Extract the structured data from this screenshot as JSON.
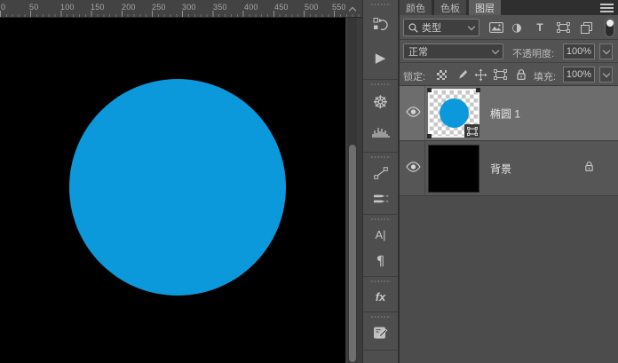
{
  "colors": {
    "shape_blue": "#0b99db",
    "canvas_black": "#000000",
    "panel_bg": "#535353",
    "selected_row": "#6d6d6d"
  },
  "ruler": {
    "labels": [
      "0",
      "50",
      "100",
      "150",
      "200",
      "250",
      "300",
      "350",
      "400",
      "450",
      "500",
      "550"
    ]
  },
  "dock": {
    "icons": [
      {
        "name": "history-panel-icon"
      },
      {
        "name": "actions-panel-icon",
        "glyph": "▶"
      },
      {
        "name": "navigator-panel-icon",
        "glyph": "☸"
      },
      {
        "name": "histogram-panel-icon"
      },
      {
        "name": "info-panel-icon"
      },
      {
        "name": "brush-panel-icon"
      },
      {
        "name": "character-panel-icon",
        "glyph": "A|"
      },
      {
        "name": "paragraph-panel-icon",
        "glyph": "¶"
      },
      {
        "name": "styles-panel-icon",
        "glyph": "fx"
      },
      {
        "name": "clone-source-panel-icon"
      }
    ]
  },
  "panel": {
    "tabs": [
      {
        "label": "颜色",
        "active": false
      },
      {
        "label": "色板",
        "active": false
      },
      {
        "label": "图层",
        "active": true
      }
    ],
    "filter": {
      "search_label": "类型",
      "adjustment_glyph": "◑",
      "type_glyph": "T"
    },
    "blend_mode": "正常",
    "opacity_label": "不透明度:",
    "opacity_value": "100%",
    "lock_label": "锁定:",
    "fill_label": "填充:",
    "fill_value": "100%",
    "layers": [
      {
        "name": "椭圆 1",
        "visible": true,
        "selected": true,
        "kind": "shape"
      },
      {
        "name": "背景",
        "visible": true,
        "locked": true,
        "kind": "background"
      }
    ]
  }
}
